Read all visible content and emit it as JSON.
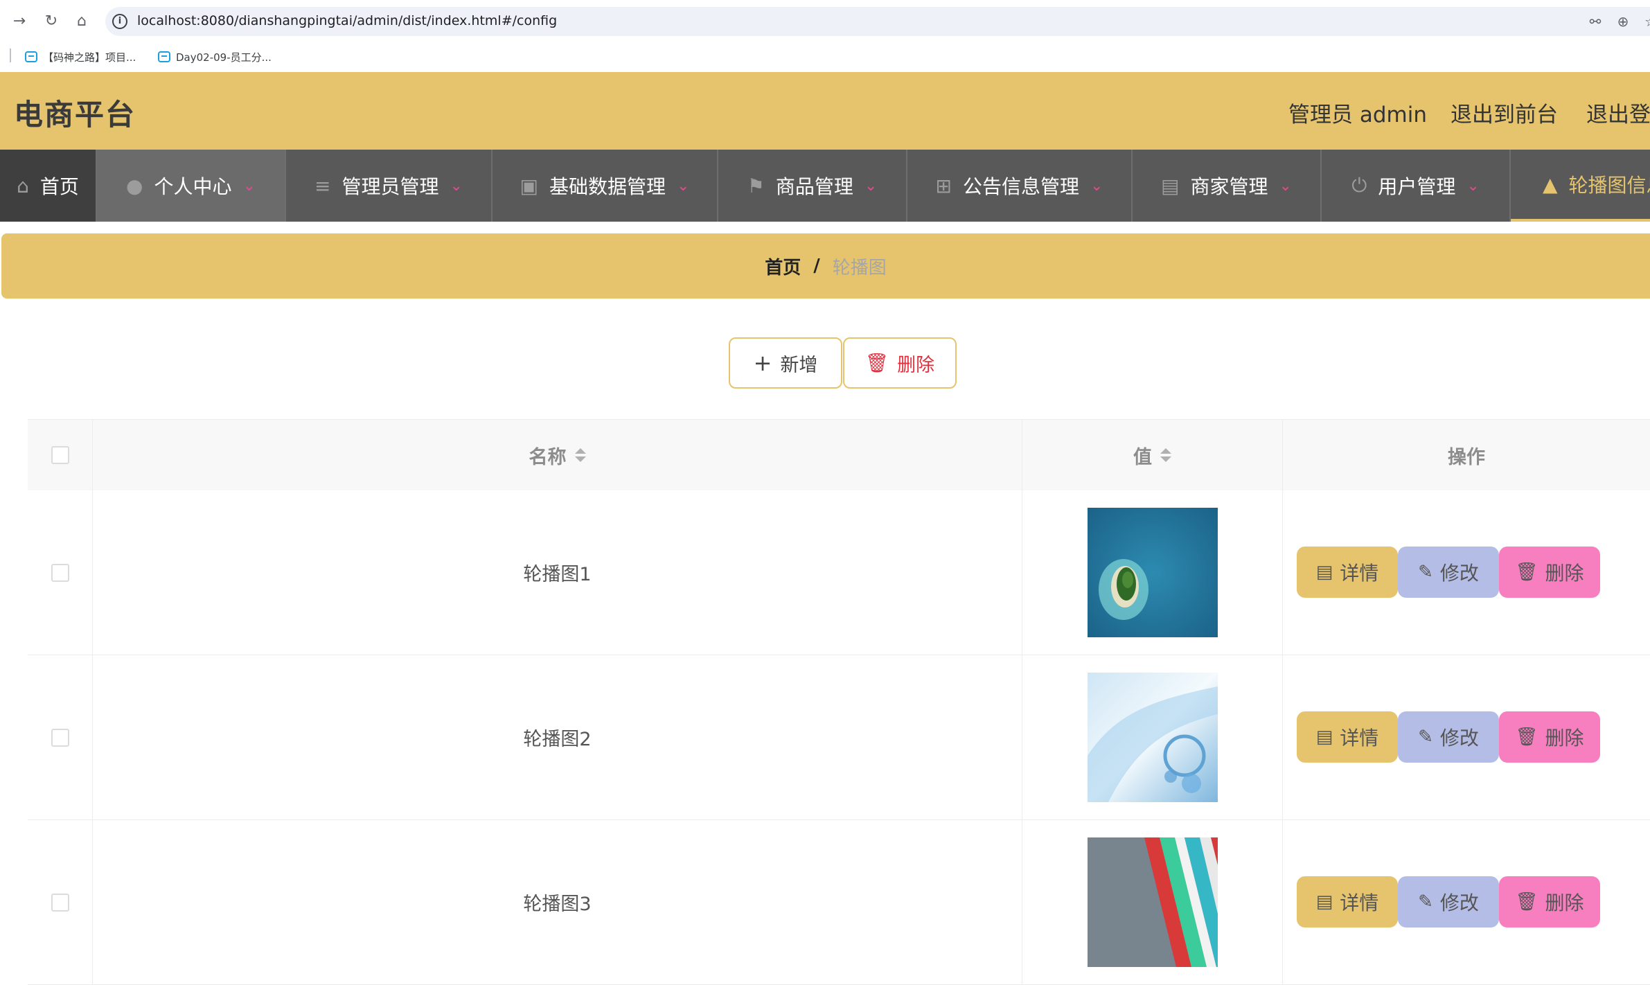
{
  "browser": {
    "url": "localhost:8080/dianshangpingtai/admin/dist/index.html#/config",
    "bookmarks": [
      "【码神之路】项目...",
      "Day02-09-员工分..."
    ]
  },
  "header": {
    "title": "电商平台",
    "admin_label": "管理员 admin",
    "exit_front": "退出到前台",
    "logout": "退出登录"
  },
  "menu": {
    "items": [
      {
        "label": "首页",
        "icon": "home-icon"
      },
      {
        "label": "个人中心",
        "icon": "user-icon"
      },
      {
        "label": "管理员管理",
        "icon": "sliders-icon"
      },
      {
        "label": "基础数据管理",
        "icon": "briefcase-icon"
      },
      {
        "label": "商品管理",
        "icon": "flag-icon"
      },
      {
        "label": "公告信息管理",
        "icon": "crop-icon"
      },
      {
        "label": "商家管理",
        "icon": "clipboard-icon"
      },
      {
        "label": "用户管理",
        "icon": "power-icon"
      },
      {
        "label": "轮播图信息",
        "icon": "brush-icon"
      }
    ],
    "active_index": 8
  },
  "breadcrumb": {
    "home": "首页",
    "separator": "/",
    "current": "轮播图"
  },
  "toolbar": {
    "add_label": "新增",
    "delete_label": "删除"
  },
  "table": {
    "columns": {
      "name": "名称",
      "value": "值",
      "actions": "操作"
    },
    "rows": [
      {
        "name": "轮播图1",
        "image": "island-image"
      },
      {
        "name": "轮播图2",
        "image": "water-splash-image"
      },
      {
        "name": "轮播图3",
        "image": "stripes-image"
      }
    ],
    "row_actions": {
      "detail": "详情",
      "edit": "修改",
      "delete": "删除"
    }
  },
  "colors": {
    "accent": "#e6c46e",
    "menu_bg": "#595959",
    "edit_button": "#b4bde6",
    "delete_button": "#f77fbf",
    "danger_text": "#e0303e"
  }
}
